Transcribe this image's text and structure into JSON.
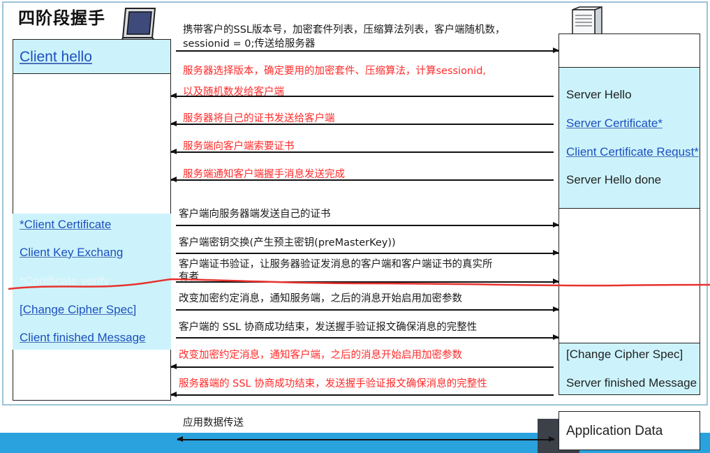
{
  "title": "四阶段握手",
  "client_labels": {
    "client_hello": "Client hello",
    "client_certificate": "*Client Certificate",
    "client_key_exchange": "Client Key Exchang",
    "certificate_verify": "*Certificate verify",
    "change_cipher_spec": "[Change Cipher Spec]",
    "client_finished": "Client finished Message"
  },
  "server_labels": {
    "server_hello": "Server Hello",
    "server_certificate": "Server Certificate*",
    "client_certificate_request": "Client Certificate Requst*",
    "server_hello_done": "Server Hello done",
    "change_cipher_spec": "[Change Cipher Spec]",
    "server_finished": "Server finished Message",
    "application_data": "Application Data"
  },
  "messages": {
    "m1_line1": "携带客户的SSL版本号，加密套件列表，压缩算法列表，客户端随机数，",
    "m1_line2": "sessionid = 0;传送给服务器",
    "m2_line1": "服务器选择版本，确定要用的加密套件、压缩算法，计算sessionid,",
    "m2_line2": "以及随机数发给客户端",
    "m3": "服务器将自己的证书发送给客户端",
    "m4": "服务端向客户端索要证书",
    "m5": "服务端通知客户端握手消息发送完成",
    "m6": "客户端向服务器端发送自己的证书",
    "m7": "客户端密钥交换(产生预主密钥(preMasterKey))",
    "m8_line1": "客户端证书验证，让服务器验证发消息的客户端和客户端证书的真实所",
    "m8_line2": "有者",
    "m9": "改变加密约定消息，通知服务端，之后的消息开始启用加密参数",
    "m10": "客户端的 SSL 协商成功结束，发送握手验证报文确保消息的完整性",
    "m11": "改变加密约定消息，通知客户端，之后的消息开始启用加密参数",
    "m12": "服务器端的 SSL 协商成功结束，发送握手验证报文确保消息的完整性",
    "m13": "应用数据传送"
  },
  "colors": {
    "cyan_fill": "#ccf3fb",
    "link_blue": "#1d4fbf",
    "red_text": "#ff2a2a",
    "red_strike": "#e8322e",
    "frame_border": "#9cc3d8",
    "bottom_band": "#2aa2de"
  },
  "icons": {
    "client_icon": "laptop-icon",
    "server_icon": "server-tower-icon"
  }
}
